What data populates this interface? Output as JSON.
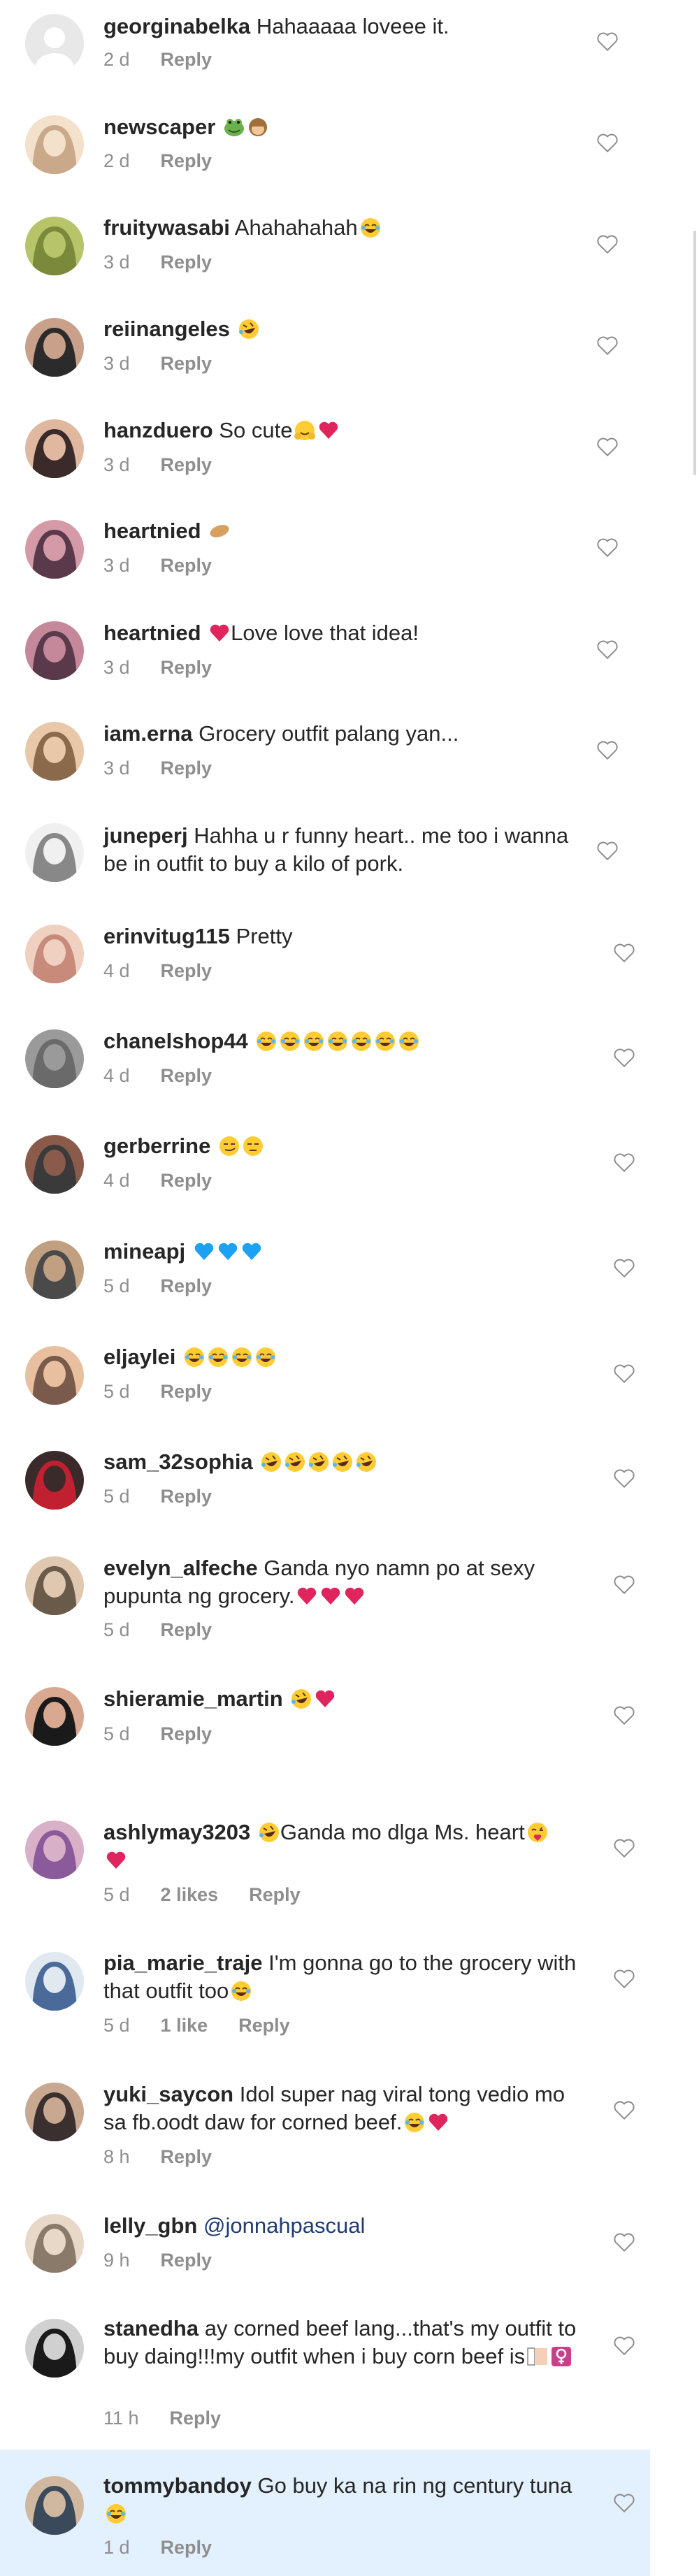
{
  "comments": [
    {
      "username": "georginabelka",
      "text": "Hahaaaaa loveee it.",
      "time": "2 d",
      "reply": "Reply"
    },
    {
      "username": "newscaper",
      "text": "",
      "time": "2 d",
      "reply": "Reply"
    },
    {
      "username": "fruitywasabi",
      "text": "Ahahahahah",
      "time": "3 d",
      "reply": "Reply"
    },
    {
      "username": "reiinangeles",
      "text": "",
      "time": "3 d",
      "reply": "Reply"
    },
    {
      "username": "hanzduero",
      "text": "So cute",
      "time": "3 d",
      "reply": "Reply"
    },
    {
      "username": "heartnied",
      "text": "",
      "time": "3 d",
      "reply": "Reply"
    },
    {
      "username": "heartnied",
      "text": "Love love that idea!",
      "time": "3 d",
      "reply": "Reply"
    },
    {
      "username": "iam.erna",
      "text": "Grocery outfit palang yan...",
      "time": "3 d",
      "reply": "Reply"
    },
    {
      "username": "juneperj",
      "text": "Hahha u r funny heart.. me too i wanna be in outfit to buy a kilo of pork.",
      "time": "",
      "reply": ""
    },
    {
      "username": "erinvitug115",
      "text": "Pretty",
      "time": "4 d",
      "reply": "Reply"
    },
    {
      "username": "chanelshop44",
      "text": "",
      "time": "4 d",
      "reply": "Reply"
    },
    {
      "username": "gerberrine",
      "text": "",
      "time": "4 d",
      "reply": "Reply"
    },
    {
      "username": "mineapj",
      "text": "",
      "time": "5 d",
      "reply": "Reply"
    },
    {
      "username": "eljaylei",
      "text": "",
      "time": "5 d",
      "reply": "Reply"
    },
    {
      "username": "sam_32sophia",
      "text": "",
      "time": "5 d",
      "reply": "Reply"
    },
    {
      "username": "evelyn_alfeche",
      "text": "Ganda nyo namn po at sexy pupunta ng grocery.",
      "time": "5 d",
      "reply": "Reply"
    },
    {
      "username": "shieramie_martin",
      "text": "",
      "time": "5 d",
      "reply": "Reply"
    },
    {
      "username": "ashlymay3203",
      "text": "Ganda mo dlga Ms. heart",
      "time": "5 d",
      "likes": "2 likes",
      "reply": "Reply"
    },
    {
      "username": "pia_marie_traje",
      "text": "I'm gonna go to the grocery with that outfit too",
      "time": "5 d",
      "likes": "1 like",
      "reply": "Reply"
    },
    {
      "username": "yuki_saycon",
      "text": "Idol super nag viral tong vedio mo sa fb.oodt daw for corned beef.",
      "time": "8 h",
      "reply": "Reply"
    },
    {
      "username": "lelly_gbn",
      "text": "",
      "mention": "@jonnahpascual",
      "time": "9 h",
      "reply": "Reply"
    },
    {
      "username": "stanedha",
      "text": "ay corned beef lang...that's my outfit to buy daing!!!my outfit when i buy corn beef is",
      "time": "11 h",
      "reply": "Reply"
    },
    {
      "username": "tommybandoy",
      "text": "Go buy ka na rin ng century tuna",
      "time": "1 d",
      "reply": "Reply"
    }
  ],
  "icons": {
    "like": "heart-outline-icon",
    "emoji_laugh": "laughing-emoji-icon",
    "emoji_rofl": "rofl-emoji-icon",
    "emoji_heart": "red-heart-icon",
    "emoji_blue_heart": "blue-heart-icon"
  },
  "colors": {
    "highlight": "#e3f0fd",
    "meta_text": "#8e8e8e",
    "mention": "#1f3a75"
  }
}
